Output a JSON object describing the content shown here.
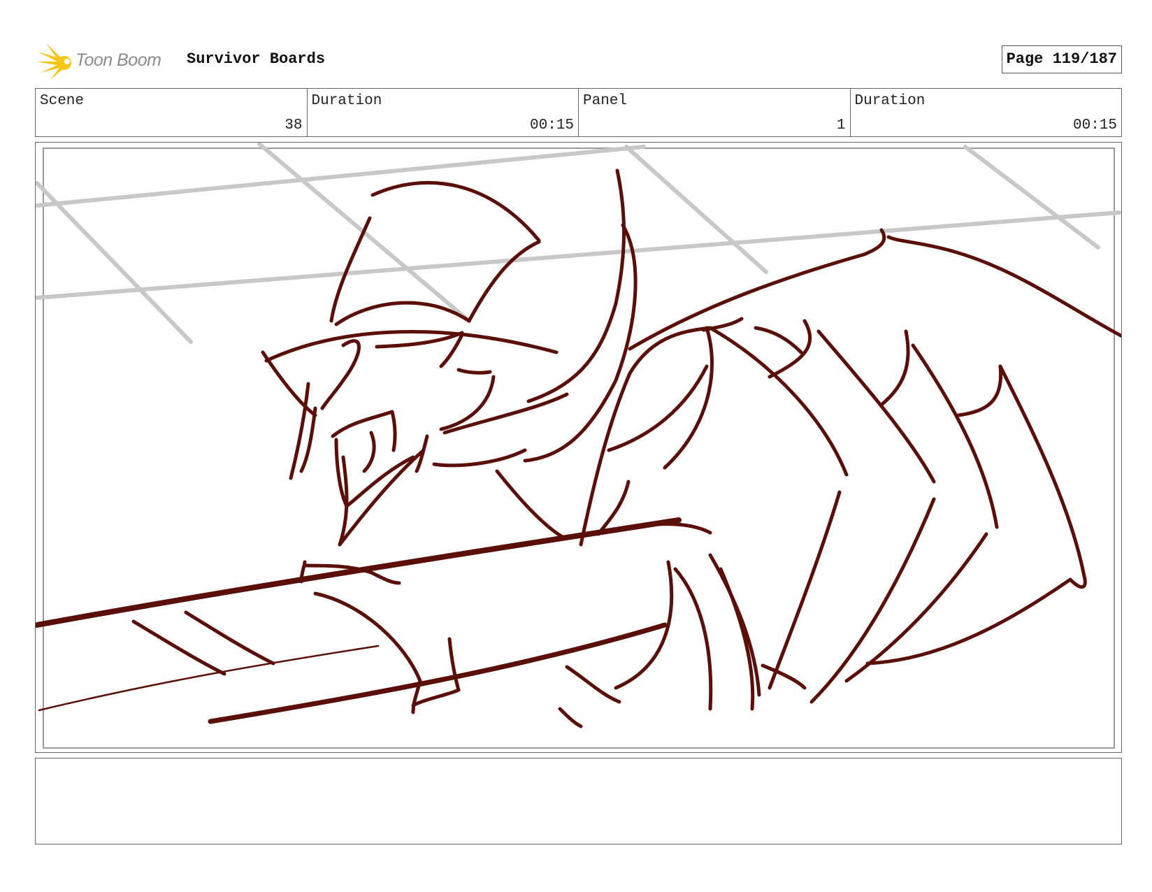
{
  "header": {
    "logo_text": "Toon Boom",
    "title": "Survivor Boards",
    "page_label": "Page 119/187"
  },
  "info": {
    "scene_label": "Scene",
    "scene_value": "38",
    "scene_duration_label": "Duration",
    "scene_duration_value": "00:15",
    "panel_label": "Panel",
    "panel_value": "1",
    "panel_duration_label": "Duration",
    "panel_duration_value": "00:15"
  },
  "colors": {
    "sketch_line": "#5a0f08",
    "guide_line": "#c8c8c8",
    "logo_star": "#f5c518",
    "border": "#666666"
  },
  "notes": {
    "text": ""
  }
}
